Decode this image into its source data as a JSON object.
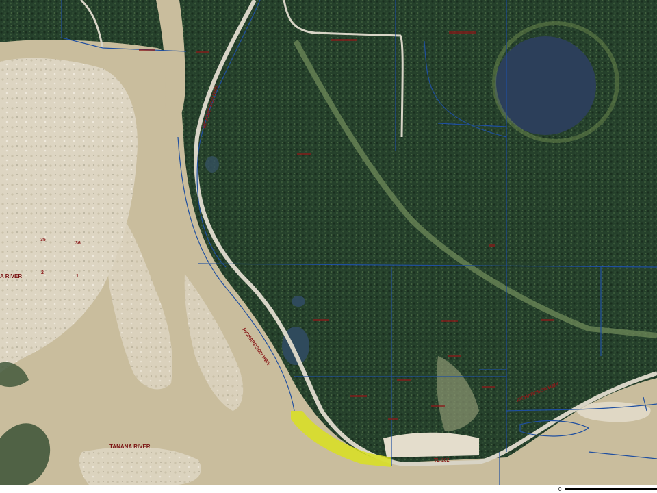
{
  "map": {
    "labels": {
      "highway_north": "RICHARDSON HWY",
      "highway_south": "RICHARDSON HWY",
      "highway_east": "RICHARDSON HWY",
      "river_west": "A RIVER",
      "river_south": "TANANA RIVER",
      "section_35": "35",
      "section_36": "36",
      "section_2": "2",
      "section_1": "1",
      "road_code": "TL-102"
    },
    "colors": {
      "forest": "#25402b",
      "river": "#c9bd9d",
      "gravel": "#e4ddcc",
      "lake": "#2c3f5a",
      "parcel_lines": "#1f4fa0",
      "road": "#d8d4c6",
      "highlight": "#d9e021",
      "label": "#8a1a1a"
    }
  },
  "scale": {
    "zero_label": "0"
  }
}
